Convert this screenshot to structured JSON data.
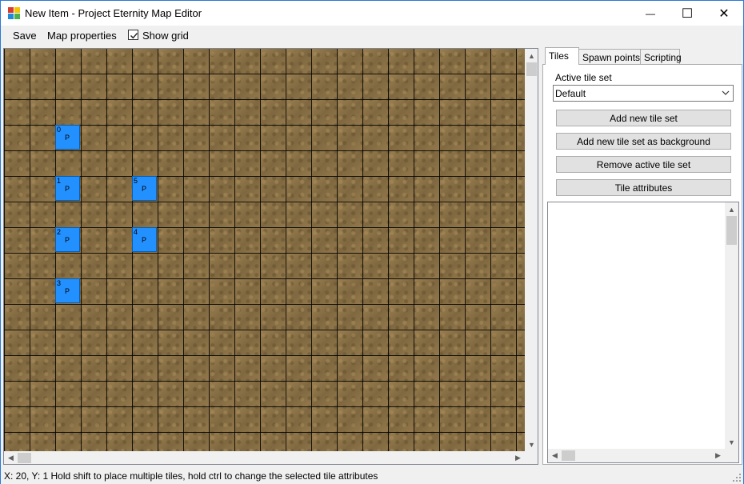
{
  "window": {
    "title": "New Item - Project Eternity Map Editor",
    "controls": {
      "minimize": "—",
      "maximize": "☐",
      "close": "✕"
    }
  },
  "menubar": {
    "save": "Save",
    "map_properties": "Map properties",
    "show_grid": "Show grid",
    "show_grid_checked": true
  },
  "map": {
    "tiles": [
      {
        "number": "0",
        "label": "P"
      },
      {
        "number": "1",
        "label": "P"
      },
      {
        "number": "2",
        "label": "P"
      },
      {
        "number": "3",
        "label": "P"
      },
      {
        "number": "5",
        "label": "P"
      },
      {
        "number": "4",
        "label": "P"
      }
    ]
  },
  "side_panel": {
    "tabs": [
      {
        "label": "Tiles"
      },
      {
        "label": "Spawn points"
      },
      {
        "label": "Scripting"
      }
    ],
    "active_tab": "Tiles",
    "active_tile_set_label": "Active tile set",
    "active_tile_set_value": "Default",
    "buttons": {
      "add_tile_set": "Add new tile set",
      "add_tile_set_background": "Add new tile set as background",
      "remove_tile_set": "Remove active tile set",
      "tile_attributes": "Tile attributes"
    }
  },
  "status": {
    "text": "X: 20, Y: 1 Hold shift to place multiple tiles, hold ctrl to change the selected tile attributes"
  },
  "colors": {
    "accent": "#2b79d7",
    "spawn_tile": "#2390ff",
    "ground": "#8c7448"
  }
}
